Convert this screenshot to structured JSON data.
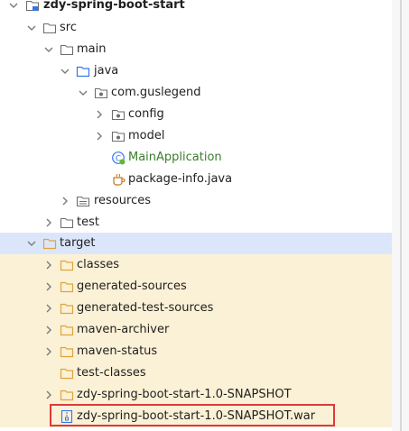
{
  "project_tree": {
    "root": {
      "label": "zdy-spring-boot-start",
      "icon": "module-folder-icon"
    },
    "src": {
      "label": "src",
      "icon": "folder-icon"
    },
    "main": {
      "label": "main",
      "icon": "folder-icon"
    },
    "java": {
      "label": "java",
      "icon": "source-root-folder-icon"
    },
    "package": {
      "label": "com.guslegend",
      "icon": "package-icon"
    },
    "config": {
      "label": "config",
      "icon": "package-icon"
    },
    "model": {
      "label": "model",
      "icon": "package-icon"
    },
    "main_application": {
      "label": "MainApplication",
      "icon": "spring-boot-class-icon"
    },
    "package_info": {
      "label": "package-info.java",
      "icon": "java-file-icon"
    },
    "resources": {
      "label": "resources",
      "icon": "resources-folder-icon"
    },
    "test": {
      "label": "test",
      "icon": "folder-icon"
    },
    "target": {
      "label": "target",
      "icon": "excluded-folder-icon"
    },
    "classes": {
      "label": "classes",
      "icon": "excluded-folder-icon"
    },
    "generated_sources": {
      "label": "generated-sources",
      "icon": "excluded-folder-icon"
    },
    "generated_test_sources": {
      "label": "generated-test-sources",
      "icon": "excluded-folder-icon"
    },
    "maven_archiver": {
      "label": "maven-archiver",
      "icon": "excluded-folder-icon"
    },
    "maven_status": {
      "label": "maven-status",
      "icon": "excluded-folder-icon"
    },
    "test_classes": {
      "label": "test-classes",
      "icon": "excluded-folder-icon"
    },
    "snapshot_dir": {
      "label": "zdy-spring-boot-start-1.0-SNAPSHOT",
      "icon": "excluded-folder-icon"
    },
    "snapshot_war": {
      "label": "zdy-spring-boot-start-1.0-SNAPSHOT.war",
      "icon": "archive-file-icon"
    }
  },
  "colors": {
    "selected_row": "#dce6fb",
    "excluded_row": "#fbf1d6",
    "excluded_folder": "#e0a43a",
    "folder_outline": "#6e6e6e",
    "source_root": "#3574f0",
    "spring_class_text": "#3b7d2c",
    "highlight_border": "#e0383e"
  }
}
